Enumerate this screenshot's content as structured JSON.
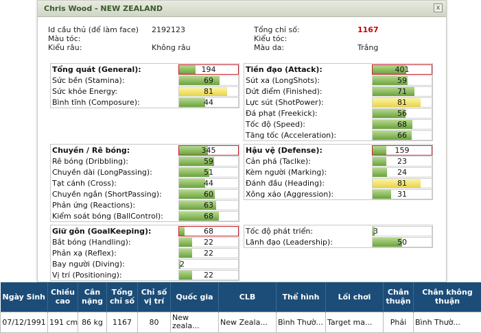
{
  "dialog": {
    "title": "Chris Wood - NEW ZEALAND",
    "close_symbol": "x"
  },
  "info": {
    "id_label": "Id cầu thủ (để làm face)",
    "id_value": "2192123",
    "total_label": "Tổng chỉ số:",
    "total_value": "1167",
    "skin_color_label": "Màu tóc:",
    "hair_style_label": "Kiểu tóc:",
    "beard_label": "Kiểu râu:",
    "beard_value": "Không râu",
    "skin_label": "Màu da:",
    "skin_value": "Trắng"
  },
  "groups": {
    "general": [
      {
        "label": "Tổng quát (General):",
        "value": 194,
        "head": true
      },
      {
        "label": "Sức bền (Stamina):",
        "value": 69
      },
      {
        "label": "Sức khỏe Energy:",
        "value": 81
      },
      {
        "label": "Bình tĩnh (Composure):",
        "value": 44
      }
    ],
    "attack": [
      {
        "label": "Tiền đạo (Attack):",
        "value": 401,
        "head": true
      },
      {
        "label": "Sút xa (LongShots):",
        "value": 59
      },
      {
        "label": "Dứt điểm (Finished):",
        "value": 71
      },
      {
        "label": "Lực sút (ShotPower):",
        "value": 81
      },
      {
        "label": "Đá phạt (Freekick):",
        "value": 56
      },
      {
        "label": "Tốc độ (Speed):",
        "value": 68
      },
      {
        "label": "Tăng tốc (Acceleration):",
        "value": 66
      }
    ],
    "dribbling": [
      {
        "label": "Chuyền / Rê bóng:",
        "value": 345,
        "head": true
      },
      {
        "label": "Rê bóng (Dribbling):",
        "value": 59
      },
      {
        "label": "Chuyền dài (LongPassing):",
        "value": 51
      },
      {
        "label": "Tạt cánh (Cross):",
        "value": 44
      },
      {
        "label": "Chuyền ngắn (ShortPassing):",
        "value": 60
      },
      {
        "label": "Phản ứng (Reactions):",
        "value": 63
      },
      {
        "label": "Kiểm soát bóng (BallControl):",
        "value": 68
      }
    ],
    "defense": [
      {
        "label": "Hậu vệ (Defense):",
        "value": 159,
        "head": true
      },
      {
        "label": "Cản phá (Taclke):",
        "value": 23
      },
      {
        "label": "Kèm người (Marking):",
        "value": 24
      },
      {
        "label": "Đánh đầu (Heading):",
        "value": 81
      },
      {
        "label": "Xông xáo (Aggression):",
        "value": 31
      }
    ],
    "goalkeeping": [
      {
        "label": "Giữ gôn (GoalKeeping):",
        "value": 68,
        "head": true
      },
      {
        "label": "Bắt bóng (Handling):",
        "value": 22
      },
      {
        "label": "Phản xạ (Reflex):",
        "value": 22
      },
      {
        "label": "Bay người (Diving):",
        "value": 2
      },
      {
        "label": "Vị trí (Positioning):",
        "value": 22
      }
    ],
    "extra": [
      {
        "label": "Tốc độ phát triển:",
        "value": 3
      },
      {
        "label": "Lãnh đạo (Leadership):",
        "value": 50
      }
    ]
  },
  "colors": {
    "bar_green": "#6aa33c",
    "bar_yellow": "#e9d34a",
    "bar_red_border": "#c0202a",
    "header_bg": "#1c4d78",
    "total_red": "#cc0000"
  },
  "table": {
    "headers": [
      "Ngày Sinh",
      "Chiều cao",
      "Cân nặng",
      "Tổng chỉ số",
      "Chỉ số vị trí",
      "Quốc gia",
      "CLB",
      "Thể hình",
      "Lối chơi",
      "Chân thuận",
      "Chân không thuận"
    ],
    "row": [
      "07/12/1991",
      "191 cm",
      "86 kg",
      "1167",
      "80",
      "New zeala...",
      "New Zeala...",
      "Bình Thườ...",
      "Target ma...",
      "Phải",
      "Bình Thườ..."
    ]
  }
}
